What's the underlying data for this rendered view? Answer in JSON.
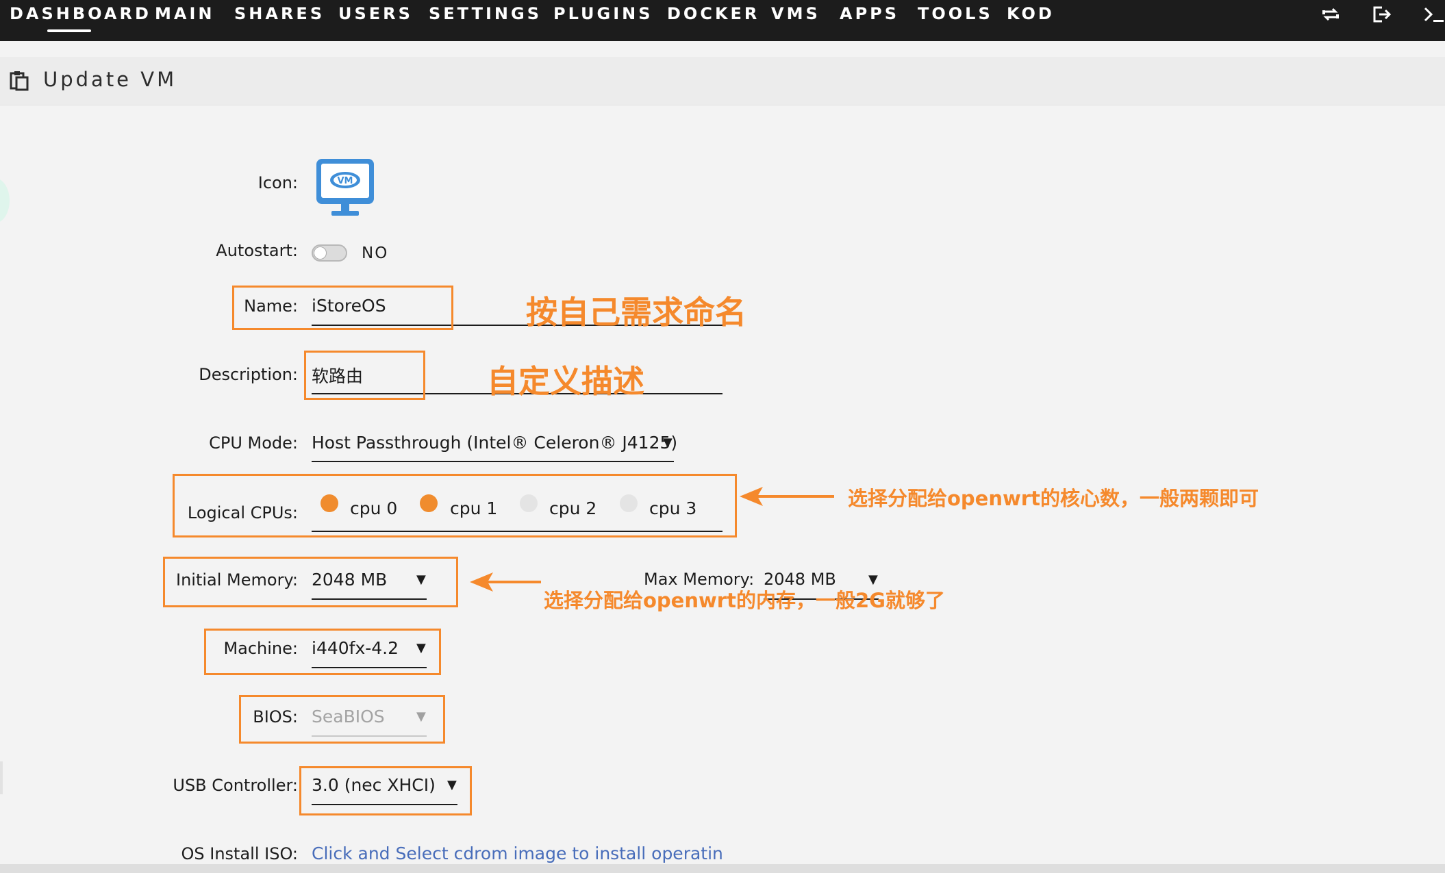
{
  "nav": {
    "items": [
      "DASHBOARD",
      "MAIN",
      "SHARES",
      "USERS",
      "SETTINGS",
      "PLUGINS",
      "DOCKER",
      "VMS",
      "APPS",
      "TOOLS",
      "KOD"
    ],
    "active": "DASHBOARD",
    "right_icons": [
      "switch-icon",
      "logout-icon",
      "terminal-icon"
    ]
  },
  "page": {
    "title": "Update VM"
  },
  "form": {
    "icon_label": "Icon:",
    "vm_icon_text": "VM",
    "autostart_label": "Autostart:",
    "autostart_value": "NO",
    "name_label": "Name:",
    "name_value": "iStoreOS",
    "description_label": "Description:",
    "description_value": "软路由",
    "cpu_mode_label": "CPU Mode:",
    "cpu_mode_value": "Host Passthrough (Intel® Celeron® J4125)",
    "logical_cpus_label": "Logical CPUs:",
    "cpus": [
      {
        "label": "cpu 0",
        "checked": true
      },
      {
        "label": "cpu 1",
        "checked": true
      },
      {
        "label": "cpu 2",
        "checked": false
      },
      {
        "label": "cpu 3",
        "checked": false
      }
    ],
    "initial_memory_label": "Initial Memory:",
    "initial_memory_value": "2048 MB",
    "max_memory_label": "Max Memory:",
    "max_memory_value": "2048 MB",
    "machine_label": "Machine:",
    "machine_value": "i440fx-4.2",
    "bios_label": "BIOS:",
    "bios_value": "SeaBIOS",
    "usb_label": "USB Controller:",
    "usb_value": "3.0 (nec XHCI)",
    "os_iso_label": "OS Install ISO:",
    "os_iso_placeholder": "Click and Select cdrom image to install operating sy"
  },
  "annotations": {
    "name_note": "按自己需求命名",
    "description_note": "自定义描述",
    "cpu_note": "选择分配给openwrt的核心数，一般两颗即可",
    "memory_note": "选择分配给openwrt的内存，一般2G就够了"
  },
  "colors": {
    "nav_bg": "#1c1c1c",
    "annotation": "#f5892c",
    "radio_on": "#f08c2e",
    "link": "#486dba",
    "vm_icon": "#3f8ed8"
  }
}
